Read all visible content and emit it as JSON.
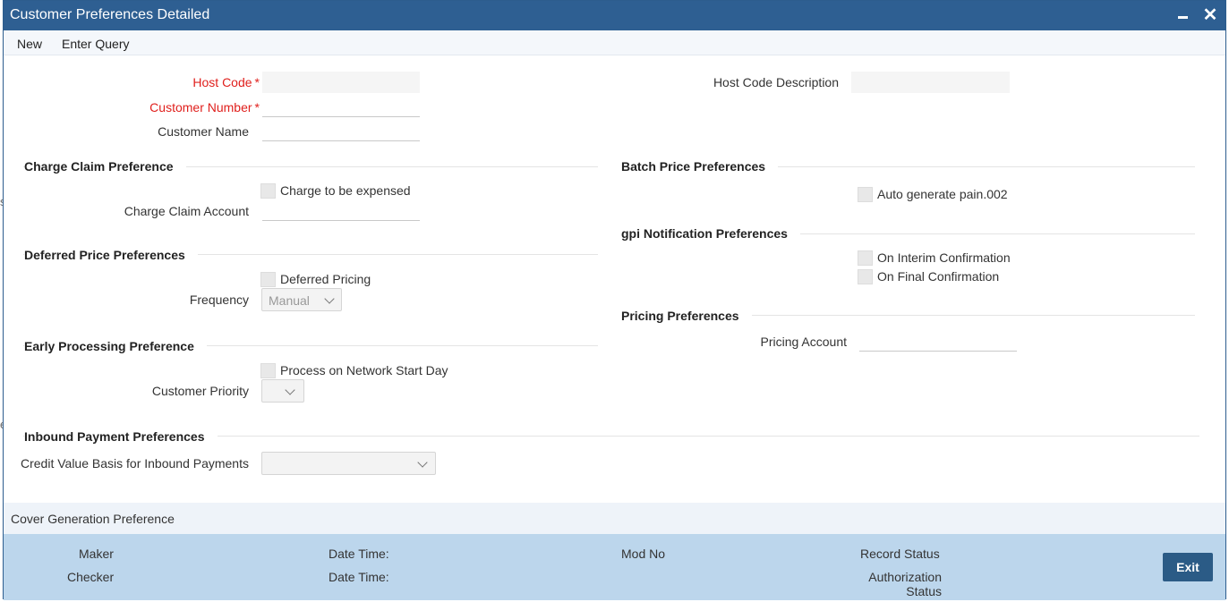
{
  "window": {
    "title": "Customer Preferences Detailed"
  },
  "menu": {
    "new": "New",
    "enter_query": "Enter Query"
  },
  "header": {
    "host_code_label": "Host Code",
    "customer_number_label": "Customer Number",
    "customer_name_label": "Customer Name",
    "host_code_description_label": "Host Code Description",
    "required_marker": "*",
    "host_code_value": "",
    "host_code_description_value": "",
    "customer_number_value": "",
    "customer_name_value": ""
  },
  "charge_claim": {
    "title": "Charge Claim Preference",
    "charge_to_be_expensed_label": "Charge to be expensed",
    "charge_to_be_expensed_checked": false,
    "charge_claim_account_label": "Charge Claim Account",
    "charge_claim_account_value": ""
  },
  "deferred_price": {
    "title": "Deferred Price Preferences",
    "deferred_pricing_label": "Deferred Pricing",
    "deferred_pricing_checked": false,
    "frequency_label": "Frequency",
    "frequency_value": "Manual"
  },
  "early_processing": {
    "title": "Early Processing Preference",
    "process_on_network_start_day_label": "Process on Network Start Day",
    "process_on_network_start_day_checked": false,
    "customer_priority_label": "Customer Priority",
    "customer_priority_value": ""
  },
  "inbound_payment": {
    "title": "Inbound Payment Preferences",
    "credit_value_basis_label": "Credit Value Basis for Inbound Payments",
    "credit_value_basis_value": ""
  },
  "batch_price": {
    "title": "Batch Price Preferences",
    "auto_generate_label": "Auto generate pain.002",
    "auto_generate_checked": false
  },
  "gpi_notification": {
    "title": "gpi Notification Preferences",
    "on_interim_label": "On Interim Confirmation",
    "on_interim_checked": false,
    "on_final_label": "On Final Confirmation",
    "on_final_checked": false
  },
  "pricing": {
    "title": "Pricing Preferences",
    "pricing_account_label": "Pricing Account",
    "pricing_account_value": ""
  },
  "cover_generation": {
    "label": "Cover Generation Preference"
  },
  "footer": {
    "maker_label": "Maker",
    "checker_label": "Checker",
    "date_time_label_1": "Date Time:",
    "date_time_label_2": "Date Time:",
    "mod_no_label": "Mod No",
    "record_status_label": "Record Status",
    "authorization_status_label_line1": "Authorization",
    "authorization_status_label_line2": "Status",
    "exit_button": "Exit"
  },
  "edge_glyphs": {
    "upper": "s",
    "lower": "e"
  },
  "colors": {
    "title_bar": "#2e5f92",
    "required": "#e0201d",
    "footer": "#bcd6ec",
    "exit_button": "#2b5b86"
  }
}
